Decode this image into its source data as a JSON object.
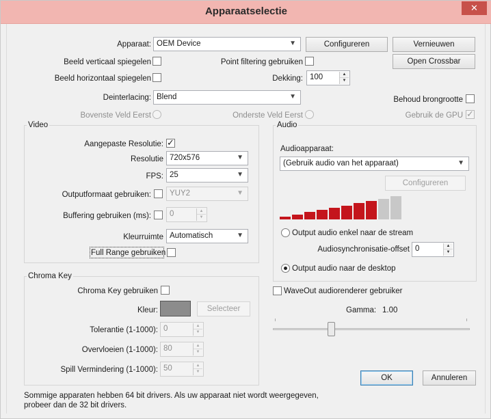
{
  "window": {
    "title": "Apparaatselectie",
    "close_glyph": "✕"
  },
  "device": {
    "label": "Apparaat:",
    "value": "OEM Device",
    "configure": "Configureren",
    "refresh": "Vernieuwen",
    "open_crossbar": "Open Crossbar"
  },
  "flip_v": {
    "label": "Beeld verticaal spiegelen",
    "checked": false
  },
  "flip_h": {
    "label": "Beeld horizontaal spiegelen",
    "checked": false
  },
  "point_filter": {
    "label": "Point filtering gebruiken",
    "checked": false
  },
  "opacity": {
    "label": "Dekking:",
    "value": "100"
  },
  "deinterlace": {
    "label": "Deinterlacing:",
    "value": "Blend"
  },
  "keep_size": {
    "label": "Behoud brongrootte",
    "checked": false
  },
  "top_field": {
    "label": "Bovenste Veld Eerst"
  },
  "bottom_field": {
    "label": "Onderste Veld Eerst"
  },
  "use_gpu": {
    "label": "Gebruik de GPU",
    "checked": true
  },
  "video": {
    "title": "Video",
    "custom_res": {
      "label": "Aangepaste Resolutie:",
      "checked": true
    },
    "resolution": {
      "label": "Resolutie",
      "value": "720x576"
    },
    "fps": {
      "label": "FPS:",
      "value": "25"
    },
    "output_format": {
      "label": "Outputformaat gebruiken:",
      "value": "YUY2"
    },
    "buffering": {
      "label": "Buffering gebruiken (ms):",
      "value": "0"
    },
    "colorspace": {
      "label": "Kleurruimte",
      "value": "Automatisch"
    },
    "full_range": {
      "label": "Full Range gebruiken"
    }
  },
  "audio": {
    "title": "Audio",
    "device_label": "Audioapparaat:",
    "device_value": "(Gebruik audio van het apparaat)",
    "configure": "Configureren",
    "meter_levels_active": 8,
    "meter_levels_total": 10,
    "meter_color_active": "#c4151c",
    "meter_color_inactive": "#c8c8c8",
    "stream_only": {
      "label": "Output audio enkel naar de stream"
    },
    "sync_offset": {
      "label": "Audiosynchronisatie-offset",
      "value": "0"
    },
    "desktop": {
      "label": "Output audio naar de desktop",
      "selected": true
    }
  },
  "chroma": {
    "title": "Chroma Key",
    "use": {
      "label": "Chroma Key gebruiken"
    },
    "color": {
      "label": "Kleur:",
      "swatch": "#8c8c8c",
      "select": "Selecteer"
    },
    "tolerance": {
      "label": "Tolerantie (1-1000):",
      "value": "0"
    },
    "blend": {
      "label": "Overvloeien (1-1000):",
      "value": "80"
    },
    "spill": {
      "label": "Spill Vermindering (1-1000):",
      "value": "50"
    }
  },
  "waveout": {
    "label": "WaveOut audiorenderer gebruiker"
  },
  "gamma": {
    "label": "Gamma:",
    "value": "1.00",
    "level": 0.3
  },
  "buttons": {
    "ok": "OK",
    "cancel": "Annuleren"
  },
  "footer": {
    "line1": "Sommige apparaten hebben 64 bit drivers. Als uw apparaat niet wordt weergegeven,",
    "line2": "probeer dan de 32 bit drivers."
  },
  "glyphs": {
    "check": "✓",
    "arrow_down": "▼",
    "spin_up": "▲",
    "spin_down": "▼"
  }
}
